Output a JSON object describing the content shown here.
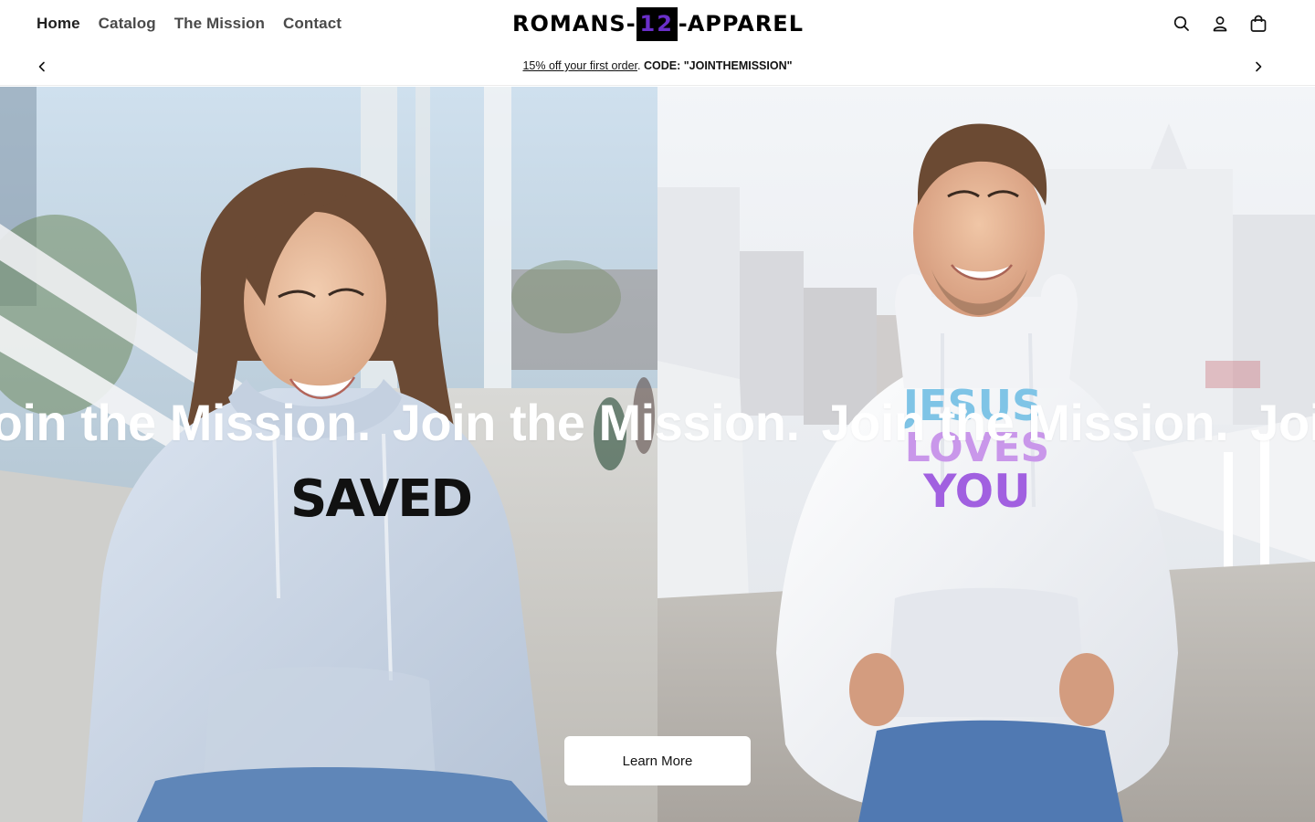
{
  "header": {
    "nav": [
      {
        "label": "Home",
        "active": true
      },
      {
        "label": "Catalog",
        "active": false
      },
      {
        "label": "The Mission",
        "active": false
      },
      {
        "label": "Contact",
        "active": false
      }
    ],
    "logo": {
      "left": "ROMANS",
      "middle": "12",
      "right": "APPAREL",
      "accent_color": "#6a2fc9"
    },
    "icons": [
      "search-icon",
      "account-icon",
      "cart-icon"
    ]
  },
  "announcement": {
    "link_text": "15% off your first order",
    "separator": ".",
    "code_text": "CODE: \"JOINTHEMISSION\""
  },
  "hero": {
    "marquee_text": "Join the Mission.",
    "left_image": {
      "shirt_print": "SAVED",
      "description": "woman-in-light-blue-hoodie"
    },
    "right_image": {
      "shirt_print_lines": [
        "JESUS",
        "LOVES",
        "YOU"
      ],
      "description": "man-in-white-hoodie"
    },
    "cta_label": "Learn More"
  }
}
